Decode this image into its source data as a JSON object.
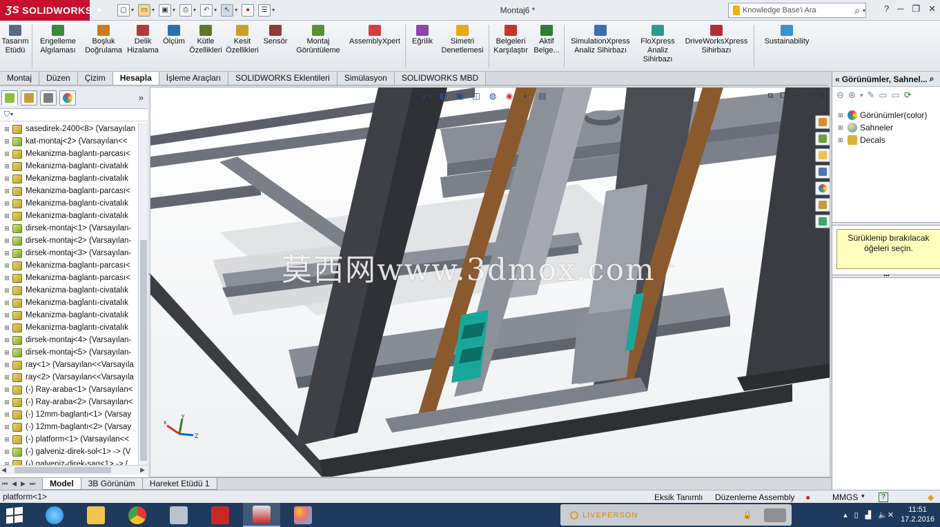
{
  "app": {
    "brand": "SOLIDWORKS",
    "document_title": "Montaj6 *",
    "search_placeholder": "Knowledge Base'i Ara",
    "help_label": "?"
  },
  "command_manager": [
    {
      "label": "Tasarım Etüdü",
      "icon": "design-study-icon",
      "color": "#5a6a80"
    },
    {
      "label": "Engelleme Algılaması",
      "icon": "interference-icon",
      "color": "#3b8a3b"
    },
    {
      "label": "Boşluk Doğrulama",
      "icon": "clearance-icon",
      "color": "#c87d1e"
    },
    {
      "label": "Delik Hizalama",
      "icon": "hole-align-icon",
      "color": "#b23a3a"
    },
    {
      "label": "Ölçüm",
      "icon": "measure-icon",
      "color": "#2a6fb3"
    },
    {
      "label": "Kütle Özellikleri",
      "icon": "mass-properties-icon",
      "color": "#5e7a2a"
    },
    {
      "label": "Kesit Özellikleri",
      "icon": "section-properties-icon",
      "color": "#c9a12a"
    },
    {
      "label": "Sensör",
      "icon": "sensor-icon",
      "color": "#8c3b3b"
    },
    {
      "label": "Montaj Görüntüleme",
      "icon": "assembly-visualization-icon",
      "color": "#5b8f35"
    },
    {
      "label": "AssemblyXpert",
      "icon": "assemblyxpert-icon",
      "color": "#d23f3f"
    },
    {
      "label": "Eğrilik",
      "icon": "curvature-icon",
      "color": "#8e44ad"
    },
    {
      "label": "Simetri Denetlemesi",
      "icon": "symmetry-icon",
      "color": "#e6a817"
    },
    {
      "label": "Belgeleri Karşılaştır",
      "icon": "compare-docs-icon",
      "color": "#c0392b"
    },
    {
      "label": "Aktif Belge...",
      "icon": "active-doc-icon",
      "color": "#2e7d32"
    },
    {
      "label": "SimulationXpress Analiz Sihirbazı",
      "icon": "simulationxpress-icon",
      "color": "#3d6eb0"
    },
    {
      "label": "FloXpress Analiz Sihirbazı",
      "icon": "floxpress-icon",
      "color": "#2f9a8a"
    },
    {
      "label": "DriveWorksXpress Sihirbazı",
      "icon": "driveworksxpress-icon",
      "color": "#b22d3a"
    },
    {
      "label": "Sustainability",
      "icon": "sustainability-icon",
      "color": "#3f8fd0"
    }
  ],
  "tabs": [
    "Montaj",
    "Düzen",
    "Çizim",
    "Hesapla",
    "İşleme Araçları",
    "SOLIDWORKS Eklentileri",
    "Simülasyon",
    "SOLIDWORKS MBD"
  ],
  "active_tab": "Hesapla",
  "feature_tree": [
    {
      "label": "sasedirek-2400<8> (Varsayılan",
      "type": "part"
    },
    {
      "label": "kat-montaj<2> (Varsayılan<<",
      "type": "assembly"
    },
    {
      "label": "Mekanizma-baglantı-parcası<",
      "type": "part"
    },
    {
      "label": "Mekanizma-baglantı-civatalık",
      "type": "part"
    },
    {
      "label": "Mekanizma-baglantı-civatalık",
      "type": "part"
    },
    {
      "label": "Mekanizma-baglantı-parcası<",
      "type": "part"
    },
    {
      "label": "Mekanizma-baglantı-civatalık",
      "type": "part"
    },
    {
      "label": "Mekanizma-baglantı-civatalık",
      "type": "part"
    },
    {
      "label": "dirsek-montaj<1> (Varsayılan-",
      "type": "assembly"
    },
    {
      "label": "dirsek-montaj<2> (Varsayılan-",
      "type": "assembly"
    },
    {
      "label": "dirsek-montaj<3> (Varsayılan-",
      "type": "assembly"
    },
    {
      "label": "Mekanizma-baglantı-parcası<",
      "type": "part"
    },
    {
      "label": "Mekanizma-baglantı-parcası<",
      "type": "part"
    },
    {
      "label": "Mekanizma-baglantı-civatalık",
      "type": "part"
    },
    {
      "label": "Mekanizma-baglantı-civatalık",
      "type": "part"
    },
    {
      "label": "Mekanizma-baglantı-civatalık",
      "type": "part"
    },
    {
      "label": "Mekanizma-baglantı-civatalık",
      "type": "part"
    },
    {
      "label": "dirsek-montaj<4> (Varsayılan-",
      "type": "assembly"
    },
    {
      "label": "dirsek-montaj<5> (Varsayılan-",
      "type": "assembly"
    },
    {
      "label": "ray<1> (Varsayılan<<Varsayıla",
      "type": "part"
    },
    {
      "label": "ray<2> (Varsayılan<<Varsayıla",
      "type": "part"
    },
    {
      "label": "(-) Ray-araba<1> (Varsayılan<",
      "type": "part"
    },
    {
      "label": "(-) Ray-araba<2> (Varsayılan<",
      "type": "part"
    },
    {
      "label": "(-) 12mm-baglantı<1> (Varsay",
      "type": "part"
    },
    {
      "label": "(-) 12mm-baglantı<2> (Varsay",
      "type": "part"
    },
    {
      "label": "(-) platform<1> (Varsayılan<<",
      "type": "part"
    },
    {
      "label": "(-) galveniz-direk-sol<1> -> (V",
      "type": "assembly"
    },
    {
      "label": "(-) galveniz-direk-sag<1> -> (",
      "type": "part"
    }
  ],
  "bottom_tabs": [
    "Model",
    "3B Görünüm",
    "Hareket Etüdü 1"
  ],
  "active_bottom_tab": "Model",
  "viewport": {
    "watermark": "莫西网www.3dmox.com",
    "triad_x": "x",
    "triad_y": "Y",
    "triad_z": "Z"
  },
  "task_pane": {
    "title": "Görünümler, Sahnel...",
    "items": [
      "Görünümler(color)",
      "Sahneler",
      "Decals"
    ],
    "drop_hint": "Sürüklenip bırakılacak öğeleri seçin."
  },
  "status_bar": {
    "selection": "platform<1>",
    "definition": "Eksik Tanımlı",
    "mode": "Düzenleme Assembly",
    "units": "MMGS",
    "help": "?"
  },
  "taskbar": {
    "liveperson": "LIVEPERSON",
    "time": "11:51",
    "date": "17.2.2016"
  }
}
